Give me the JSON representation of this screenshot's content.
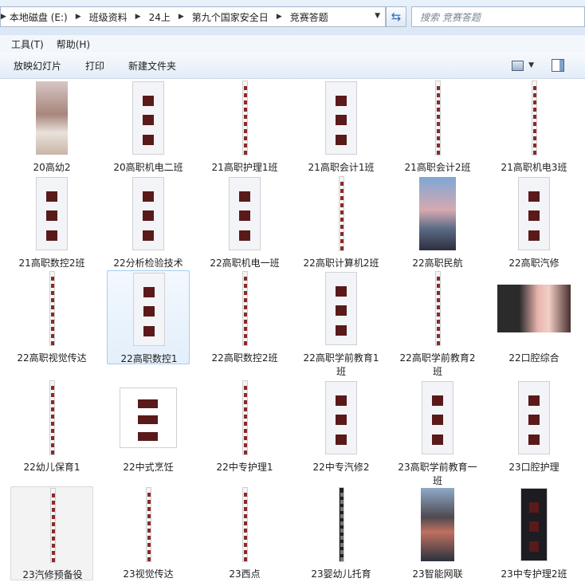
{
  "address": {
    "crumbs": [
      "本地磁盘 (E:)",
      "班级资料",
      "24上",
      "第九个国家安全日",
      "竞赛答题"
    ]
  },
  "search": {
    "placeholder": "搜索 竞赛答题"
  },
  "menu": {
    "tools": "工具(T)",
    "help": "帮助(H)"
  },
  "commands": {
    "slideshow": "放映幻灯片",
    "print": "打印",
    "new_folder": "新建文件夹"
  },
  "files": [
    {
      "name": "20高幼2",
      "thumb": "photo-face"
    },
    {
      "name": "20高职机电二班",
      "thumb": "chat-screenshot"
    },
    {
      "name": "21高职护理1班",
      "thumb": "long-strip"
    },
    {
      "name": "21高职会计1班",
      "thumb": "chat-screenshot"
    },
    {
      "name": "21高职会计2班",
      "thumb": "long-strip"
    },
    {
      "name": "21高职机电3班",
      "thumb": "long-strip"
    },
    {
      "name": "21高职数控2班",
      "thumb": "chat-screenshot"
    },
    {
      "name": "22分析检验技术",
      "thumb": "chat-screenshot"
    },
    {
      "name": "22高职机电一班",
      "thumb": "chat-screenshot"
    },
    {
      "name": "22高职计算机2班",
      "thumb": "long-strip"
    },
    {
      "name": "22高职民航",
      "thumb": "photo-sky"
    },
    {
      "name": "22高职汽修",
      "thumb": "chat-screenshot"
    },
    {
      "name": "22高职视觉传达",
      "thumb": "long-strip"
    },
    {
      "name": "22高职数控1",
      "thumb": "chat-screenshot"
    },
    {
      "name": "22高职数控2班",
      "thumb": "long-strip"
    },
    {
      "name": "22高职学前教育1班",
      "thumb": "chat-screenshot"
    },
    {
      "name": "22高职学前教育2班",
      "thumb": "long-strip"
    },
    {
      "name": "22口腔综合",
      "thumb": "photo-flowers"
    },
    {
      "name": "22幼儿保育1",
      "thumb": "long-strip"
    },
    {
      "name": "22中式烹饪",
      "thumb": "app-screenshot"
    },
    {
      "name": "22中专护理1",
      "thumb": "long-strip"
    },
    {
      "name": "22中专汽修2",
      "thumb": "chat-screenshot"
    },
    {
      "name": "23高职学前教育一班",
      "thumb": "chat-screenshot"
    },
    {
      "name": "23口腔护理",
      "thumb": "chat-screenshot"
    },
    {
      "name": "23汽修预备役",
      "thumb": "long-strip"
    },
    {
      "name": "23视觉传达",
      "thumb": "long-strip"
    },
    {
      "name": "23西点",
      "thumb": "long-strip"
    },
    {
      "name": "23婴幼儿托育",
      "thumb": "long-strip-dark"
    },
    {
      "name": "23智能网联",
      "thumb": "photo-city"
    },
    {
      "name": "23中专护理2班",
      "thumb": "dark-screenshot"
    }
  ],
  "selected_file": "22高职数控1",
  "hovered_file": "23汽修预备役",
  "colors": {
    "selection_bg": "#e3effb",
    "selection_border": "#a7cdf0",
    "toolbar_bg": "#e3ecf7"
  }
}
